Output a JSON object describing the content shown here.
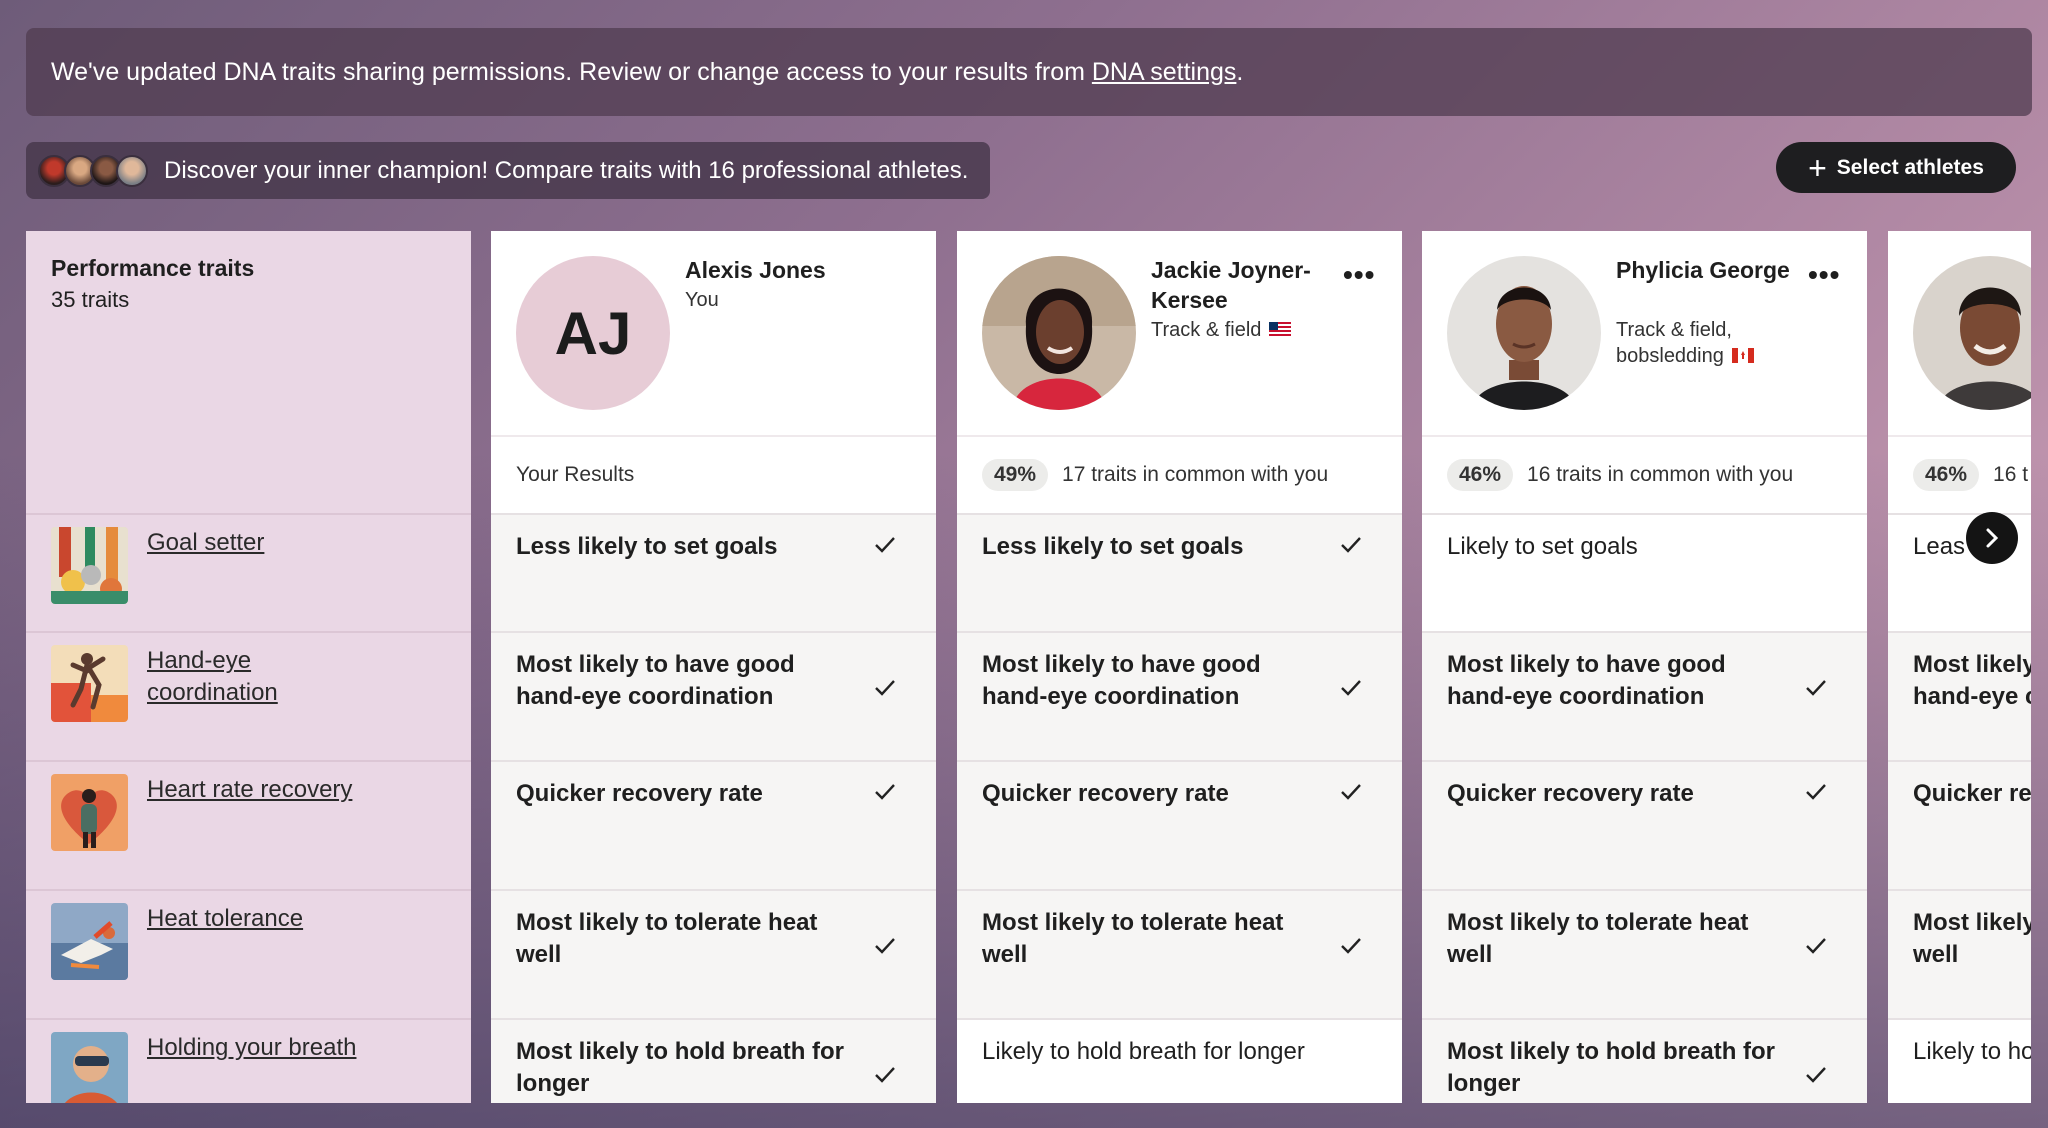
{
  "banner": {
    "text": "We've updated DNA traits sharing permissions. Review or change access to your results from ",
    "link": "DNA settings",
    "suffix": "."
  },
  "discover": {
    "text": "Discover your inner champion! Compare traits with 16 professional athletes."
  },
  "select_button": {
    "label": "Select athletes"
  },
  "traits_panel": {
    "title": "Performance traits",
    "count": "35 traits"
  },
  "traits": [
    {
      "label": "Goal setter",
      "icon": "goal-setter-thumb"
    },
    {
      "label": "Hand-eye coordination",
      "icon": "hand-eye-thumb"
    },
    {
      "label": "Heart rate recovery",
      "icon": "heart-rate-thumb"
    },
    {
      "label": "Heat tolerance",
      "icon": "heat-tolerance-thumb"
    },
    {
      "label": "Holding your breath",
      "icon": "breath-thumb"
    }
  ],
  "people": [
    {
      "name": "Alexis Jones",
      "meta": "You",
      "initials": "AJ",
      "summary": "Your Results",
      "results": [
        "Less likely to set goals",
        "Most likely to have good hand-eye coordination",
        "Quicker recovery rate",
        "Most likely to tolerate heat well",
        "Most likely to hold breath for longer"
      ]
    },
    {
      "name": "Jackie Joyner-Kersee",
      "meta": "Track & field",
      "pct": "49%",
      "summary": "17 traits in common with you",
      "results": [
        "Less likely to set goals",
        "Most likely to have good hand-eye coordination",
        "Quicker recovery rate",
        "Most likely to tolerate heat well",
        "Likely to hold breath for longer"
      ]
    },
    {
      "name": "Phylicia George",
      "meta": "Track & field, bobsledding",
      "pct": "46%",
      "summary": "16 traits in common with you",
      "results": [
        "Likely to set goals",
        "Most likely to have good hand-eye coordination",
        "Quicker recovery rate",
        "Most likely to tolerate heat well",
        "Most likely to hold breath for longer"
      ]
    },
    {
      "pct": "46%",
      "summary": "16 t",
      "results": [
        "Leas",
        "Most likely hand-eye c",
        "Quicker re",
        "Most likely well",
        "Likely to ho"
      ]
    }
  ],
  "colors": {
    "accent_dark": "#1e1e20",
    "trait_panel": "#ead7e5"
  }
}
